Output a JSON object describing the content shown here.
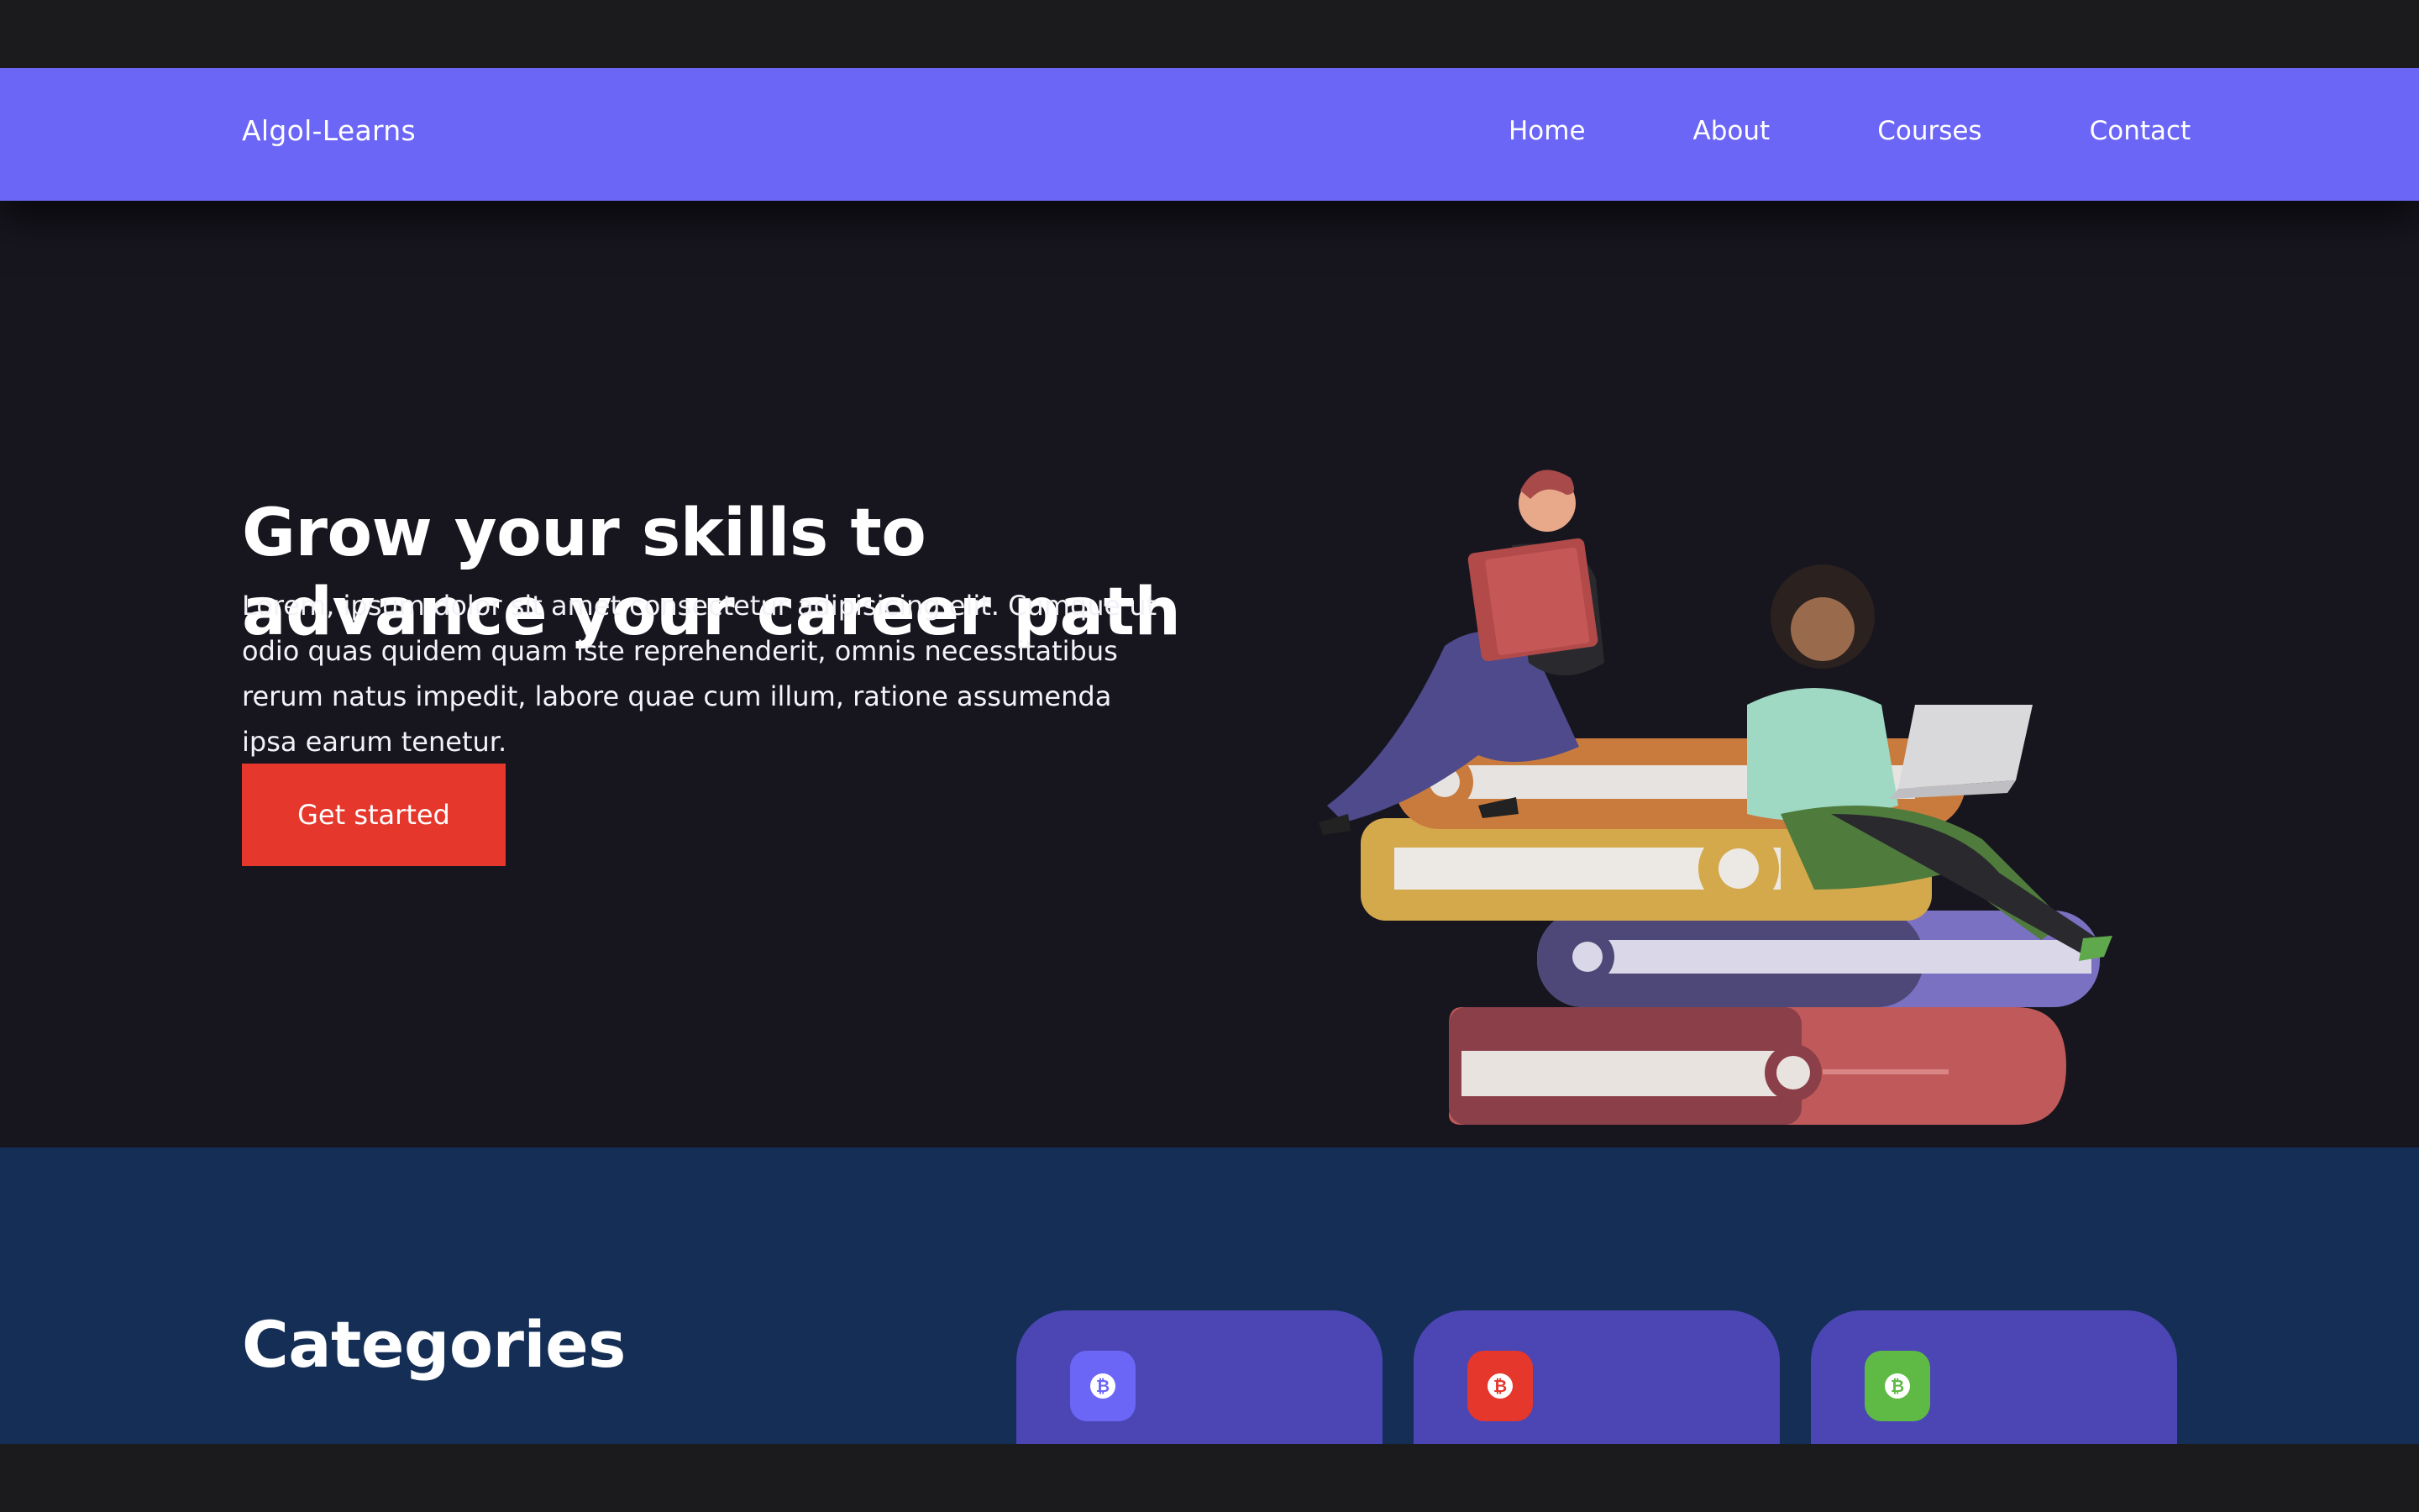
{
  "navbar": {
    "brand": "Algol-Learns",
    "links": [
      "Home",
      "About",
      "Courses",
      "Contact"
    ],
    "background": "#6b66f6"
  },
  "hero": {
    "title": "Grow your skills to advance your career path",
    "text": "Lorem, ipsum dolor sit amet consectetur adipisicing elit. Cumque ut odio quas quidem quam iste reprehenderit, omnis necessitatibus rerum natus impedit, labore quae cum illum, ratione assumenda ipsa earum tenetur.",
    "cta_label": "Get started",
    "cta_color": "#e5372c",
    "illustration": "people-reading-on-books-illustration"
  },
  "categories": {
    "title": "Categories",
    "background": "#142e55",
    "cards": [
      {
        "icon": "bitcoin-icon",
        "icon_color": "#6b66f6",
        "glyph": "₿"
      },
      {
        "icon": "bitcoin-icon",
        "icon_color": "#e5372c",
        "glyph": "₿"
      },
      {
        "icon": "bitcoin-icon",
        "icon_color": "#5fba45",
        "glyph": "₿"
      }
    ]
  }
}
